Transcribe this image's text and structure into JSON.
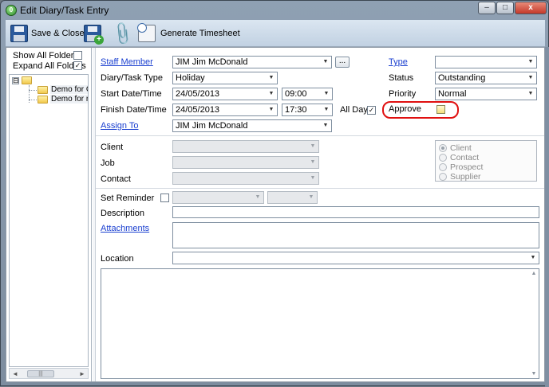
{
  "window": {
    "title": "Edit Diary/Task Entry",
    "app_icon_glyph": "0"
  },
  "window_controls": {
    "minimize": "–",
    "maximize": "□",
    "close": "x"
  },
  "toolbar": {
    "save_close_label": "Save & Close",
    "generate_timesheet_label": "Generate Timesheet"
  },
  "left_pane": {
    "show_all_folders_label": "Show All Folders",
    "show_all_folders_checked": false,
    "expand_all_folders_label": "Expand All Folders",
    "expand_all_folders_checked": true,
    "tree_expander": "⊟",
    "tree_items": [
      "Demo for C",
      "Demo for re"
    ],
    "scroll_left": "◄",
    "scroll_right": "►",
    "scroll_thumb": "|||"
  },
  "form": {
    "staff_member_label": "Staff Member",
    "staff_member_value": "JIM    Jim McDonald",
    "staff_member_button": "...",
    "type_label": "Type",
    "type_value": "",
    "diary_task_type_label": "Diary/Task Type",
    "diary_task_type_value": "Holiday",
    "status_label": "Status",
    "status_value": "Outstanding",
    "start_label": "Start Date/Time",
    "start_date": "24/05/2013",
    "start_time": "09:00",
    "priority_label": "Priority",
    "priority_value": "Normal",
    "finish_label": "Finish Date/Time",
    "finish_date": "24/05/2013",
    "finish_time": "17:30",
    "all_day_label": "All Day",
    "all_day_checked": true,
    "approve_label": "Approve",
    "approve_checked": false,
    "assign_to_label": "Assign To",
    "assign_to_value": "JIM    Jim McDonald",
    "client_label": "Client",
    "job_label": "Job",
    "contact_label": "Contact",
    "radio_options": [
      "Client",
      "Contact",
      "Prospect",
      "Supplier"
    ],
    "radio_selected": "Client",
    "set_reminder_label": "Set Reminder",
    "description_label": "Description",
    "description_value": "",
    "attachments_label": "Attachments",
    "location_label": "Location",
    "location_value": "",
    "dropdown_arrow": "▼",
    "scroll_up": "▲",
    "scroll_down": "▼",
    "check_mark": "✓"
  },
  "colors": {
    "link": "#1a3fd0",
    "highlight": "#e01010",
    "toolbar_top": "#dbe6f1",
    "window_frame": "#8fa0b3"
  }
}
